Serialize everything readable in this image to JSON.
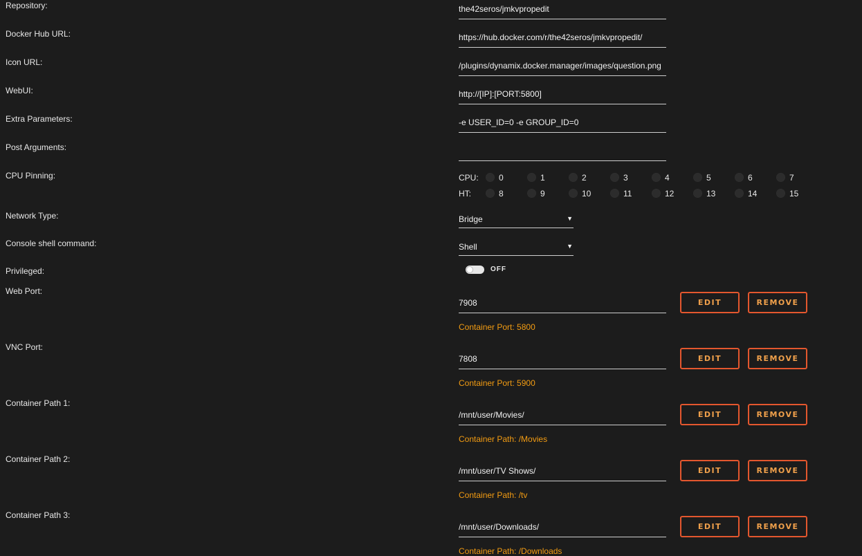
{
  "fields": [
    {
      "id": "repository",
      "label": "Repository:",
      "value": "the42seros/jmkvpropedit"
    },
    {
      "id": "docker-hub-url",
      "label": "Docker Hub URL:",
      "value": "https://hub.docker.com/r/the42seros/jmkvpropedit/"
    },
    {
      "id": "icon-url",
      "label": "Icon URL:",
      "value": "/plugins/dynamix.docker.manager/images/question.png"
    },
    {
      "id": "webui",
      "label": "WebUI:",
      "value": "http://[IP]:[PORT:5800]"
    },
    {
      "id": "extra-parameters",
      "label": "Extra Parameters:",
      "value": "-e USER_ID=0 -e GROUP_ID=0"
    },
    {
      "id": "post-arguments",
      "label": "Post Arguments:",
      "value": ""
    }
  ],
  "cpu_pinning": {
    "label": "CPU Pinning:",
    "rows": [
      {
        "label": "CPU:",
        "cores": [
          "0",
          "1",
          "2",
          "3",
          "4",
          "5",
          "6",
          "7"
        ]
      },
      {
        "label": "HT:",
        "cores": [
          "8",
          "9",
          "10",
          "11",
          "12",
          "13",
          "14",
          "15"
        ]
      }
    ]
  },
  "network_type": {
    "label": "Network Type:",
    "value": "Bridge"
  },
  "console_shell": {
    "label": "Console shell command:",
    "value": "Shell"
  },
  "privileged": {
    "label": "Privileged:",
    "state": "OFF"
  },
  "buttons": {
    "edit": "EDIT",
    "remove": "REMOVE"
  },
  "mappings": [
    {
      "label": "Web Port:",
      "value": "7908",
      "note": "Container Port: 5800"
    },
    {
      "label": "VNC Port:",
      "value": "7808",
      "note": "Container Port: 5900"
    },
    {
      "label": "Container Path 1:",
      "value": "/mnt/user/Movies/",
      "note": "Container Path: /Movies"
    },
    {
      "label": "Container Path 2:",
      "value": "/mnt/user/TV Shows/",
      "note": "Container Path: /tv"
    },
    {
      "label": "Container Path 3:",
      "value": "/mnt/user/Downloads/",
      "note": "Container Path: /Downloads"
    }
  ],
  "colors": {
    "background": "#1c1c1c",
    "accent_border": "#e4572e",
    "accent_text": "#f39c12"
  }
}
